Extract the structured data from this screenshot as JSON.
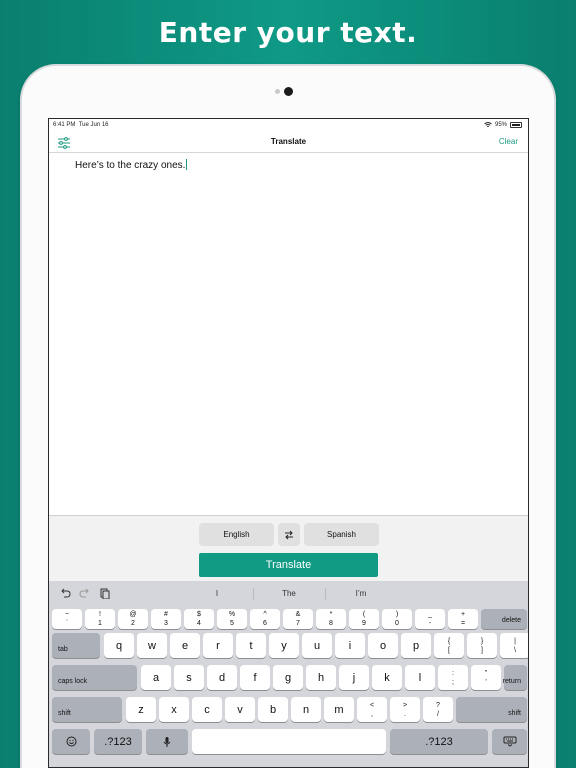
{
  "headline": "Enter your text.",
  "status": {
    "time": "6:41 PM",
    "date": "Tue Jun 16",
    "battery": "95%"
  },
  "nav": {
    "title": "Translate",
    "clear": "Clear",
    "settings_icon": "sliders-icon"
  },
  "text": {
    "content": "Here’s to the crazy ones."
  },
  "controls": {
    "source_lang": "English",
    "target_lang": "Spanish",
    "swap_icon": "swap-arrows-icon",
    "translate": "Translate"
  },
  "keyboard": {
    "suggestions": [
      "I",
      "The",
      "I’m"
    ],
    "row_numbers": [
      {
        "top": "~",
        "bottom": "`"
      },
      {
        "top": "!",
        "bottom": "1"
      },
      {
        "top": "@",
        "bottom": "2"
      },
      {
        "top": "#",
        "bottom": "3"
      },
      {
        "top": "$",
        "bottom": "4"
      },
      {
        "top": "%",
        "bottom": "5"
      },
      {
        "top": "^",
        "bottom": "6"
      },
      {
        "top": "&",
        "bottom": "7"
      },
      {
        "top": "*",
        "bottom": "8"
      },
      {
        "top": "(",
        "bottom": "9"
      },
      {
        "top": ")",
        "bottom": "0"
      },
      {
        "top": "_",
        "bottom": "-"
      },
      {
        "top": "+",
        "bottom": "="
      }
    ],
    "delete": "delete",
    "tab": "tab",
    "row_q": [
      "q",
      "w",
      "e",
      "r",
      "t",
      "y",
      "u",
      "i",
      "o",
      "p"
    ],
    "brackets": [
      {
        "top": "{",
        "bottom": "["
      },
      {
        "top": "}",
        "bottom": "]"
      },
      {
        "top": "|",
        "bottom": "\\"
      }
    ],
    "caps": "caps lock",
    "row_a": [
      "a",
      "s",
      "d",
      "f",
      "g",
      "h",
      "j",
      "k",
      "l"
    ],
    "semi": [
      {
        "top": ":",
        "bottom": ";"
      },
      {
        "top": "”",
        "bottom": "’"
      }
    ],
    "return": "return",
    "shift": "shift",
    "row_z": [
      "z",
      "x",
      "c",
      "v",
      "b",
      "n",
      "m"
    ],
    "punct": [
      {
        "top": "<",
        "bottom": ","
      },
      {
        "top": ">",
        "bottom": "."
      },
      {
        "top": "?",
        "bottom": "/"
      }
    ],
    "num": ".?123"
  }
}
